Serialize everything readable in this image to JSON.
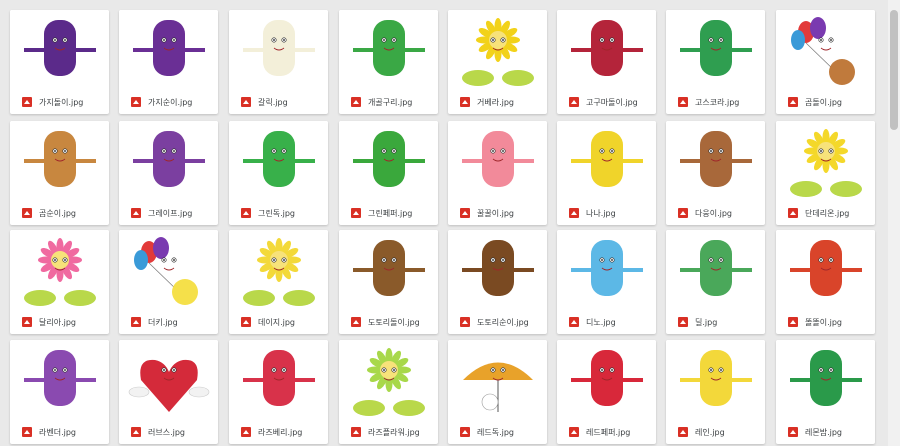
{
  "files": [
    {
      "name": "가지돌이.jpg",
      "icon": "image-file-icon",
      "drawing": "eggplant-character",
      "color": "#5b2a8a"
    },
    {
      "name": "가지순이.jpg",
      "icon": "image-file-icon",
      "drawing": "eggplant-character",
      "color": "#6a2f95"
    },
    {
      "name": "갈릭.jpg",
      "icon": "image-file-icon",
      "drawing": "garlic-character",
      "color": "#f3efd9"
    },
    {
      "name": "개골구리.jpg",
      "icon": "image-file-icon",
      "drawing": "frog-character",
      "color": "#3aa845"
    },
    {
      "name": "거베라.jpg",
      "icon": "image-file-icon",
      "drawing": "flower-character",
      "color": "#f2d21a"
    },
    {
      "name": "고구마돌이.jpg",
      "icon": "image-file-icon",
      "drawing": "sweet-potato-character",
      "color": "#b4243a"
    },
    {
      "name": "고스코라.jpg",
      "icon": "image-file-icon",
      "drawing": "broccoli-character",
      "color": "#2f9e50"
    },
    {
      "name": "곰돌이.jpg",
      "icon": "image-file-icon",
      "drawing": "bear-balloons",
      "color": "#c07a3c"
    },
    {
      "name": "곰순이.jpg",
      "icon": "image-file-icon",
      "drawing": "bear-character",
      "color": "#c8873f"
    },
    {
      "name": "그레이프.jpg",
      "icon": "image-file-icon",
      "drawing": "grape-character",
      "color": "#7b3fa0"
    },
    {
      "name": "그린독.jpg",
      "icon": "image-file-icon",
      "drawing": "green-dog-character",
      "color": "#38b04a"
    },
    {
      "name": "그린페퍼.jpg",
      "icon": "image-file-icon",
      "drawing": "green-pepper-character",
      "color": "#3aa83c"
    },
    {
      "name": "꿀꿀이.jpg",
      "icon": "image-file-icon",
      "drawing": "pig-character",
      "color": "#f28a9a"
    },
    {
      "name": "나나.jpg",
      "icon": "image-file-icon",
      "drawing": "banana-character",
      "color": "#f0d42a"
    },
    {
      "name": "다웅이.jpg",
      "icon": "image-file-icon",
      "drawing": "raccoon-character",
      "color": "#a8683a"
    },
    {
      "name": "단데리온.jpg",
      "icon": "image-file-icon",
      "drawing": "dandelion-character",
      "color": "#f4d82a"
    },
    {
      "name": "달리아.jpg",
      "icon": "image-file-icon",
      "drawing": "dahlia-character",
      "color": "#f06aa0"
    },
    {
      "name": "더키.jpg",
      "icon": "image-file-icon",
      "drawing": "duck-balloons",
      "color": "#f5e04a"
    },
    {
      "name": "데이지.jpg",
      "icon": "image-file-icon",
      "drawing": "daisy-character",
      "color": "#f3d93a"
    },
    {
      "name": "도토리돌이.jpg",
      "icon": "image-file-icon",
      "drawing": "acorn-boy-character",
      "color": "#8a5a2a"
    },
    {
      "name": "도토리순이.jpg",
      "icon": "image-file-icon",
      "drawing": "acorn-girl-character",
      "color": "#7a4a22"
    },
    {
      "name": "디노.jpg",
      "icon": "image-file-icon",
      "drawing": "dino-character",
      "color": "#5cb8e6"
    },
    {
      "name": "딜.jpg",
      "icon": "image-file-icon",
      "drawing": "dill-character",
      "color": "#4aa85a"
    },
    {
      "name": "똘똘이.jpg",
      "icon": "image-file-icon",
      "drawing": "dog-character",
      "color": "#d9442a"
    },
    {
      "name": "라벤더.jpg",
      "icon": "image-file-icon",
      "drawing": "lavender-character",
      "color": "#8a4ab0"
    },
    {
      "name": "러브스.jpg",
      "icon": "image-file-icon",
      "drawing": "heart-character",
      "color": "#d42a3a"
    },
    {
      "name": "라즈베리.jpg",
      "icon": "image-file-icon",
      "drawing": "raspberry-character",
      "color": "#d8324a"
    },
    {
      "name": "라즈플라워.jpg",
      "icon": "image-file-icon",
      "drawing": "flower-girl-character",
      "color": "#a8d84a"
    },
    {
      "name": "레드독.jpg",
      "icon": "image-file-icon",
      "drawing": "umbrella-dog",
      "color": "#e8a22a"
    },
    {
      "name": "레드페퍼.jpg",
      "icon": "image-file-icon",
      "drawing": "red-pepper-character",
      "color": "#d8283a"
    },
    {
      "name": "레인.jpg",
      "icon": "image-file-icon",
      "drawing": "raincoat-character",
      "color": "#f3d83a"
    },
    {
      "name": "레몬밤.jpg",
      "icon": "image-file-icon",
      "drawing": "lemon-balm-character",
      "color": "#2a9a4a"
    }
  ],
  "scrollbar": {
    "icon": "scrollbar-thumb"
  }
}
